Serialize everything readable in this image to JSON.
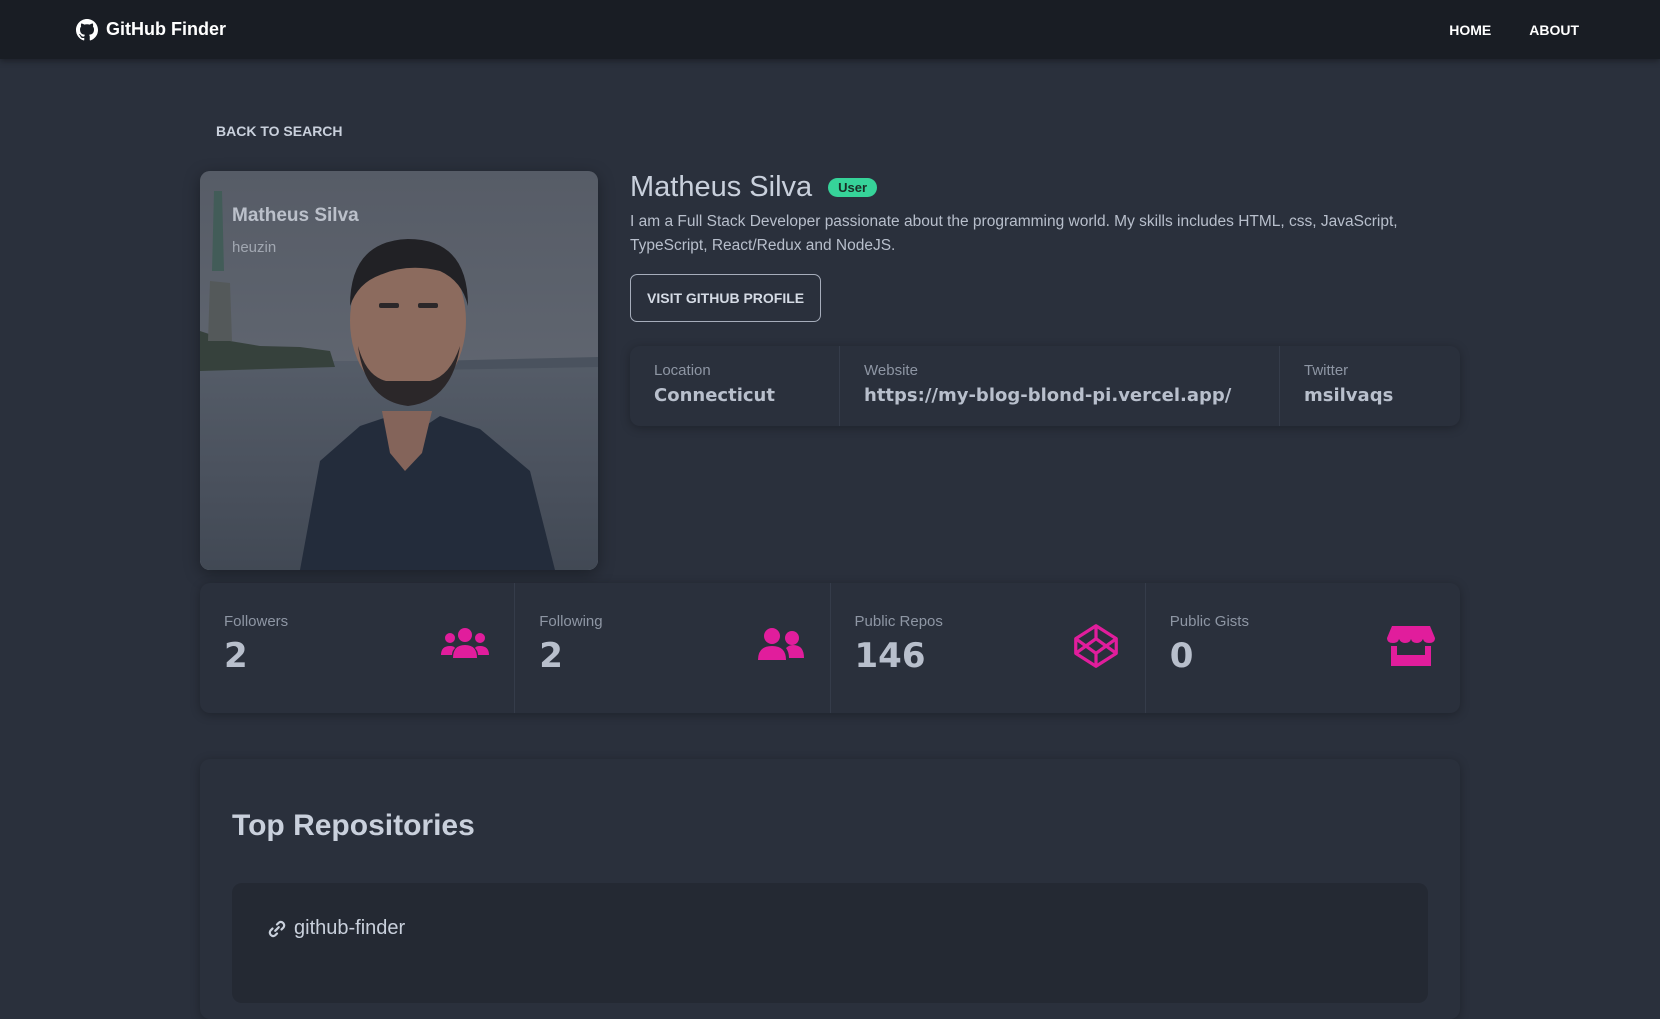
{
  "navbar": {
    "brand": "GitHub Finder",
    "brand_icon": "github-icon",
    "links": [
      "HOME",
      "ABOUT"
    ]
  },
  "back_button": "BACK TO SEARCH",
  "avatar": {
    "overlay_name": "Matheus Silva",
    "overlay_login": "heuzin"
  },
  "profile": {
    "name": "Matheus Silva",
    "badge": "User",
    "bio": "I am a Full Stack Developer passionate about the programming world. My skills includes HTML, css, JavaScript, TypeScript, React/Redux and NodeJS.",
    "visit_button": "VISIT GITHUB PROFILE"
  },
  "info": {
    "location_title": "Location",
    "location_value": "Connecticut",
    "website_title": "Website",
    "website_value": "https://my-blog-blond-pi.vercel.app/",
    "twitter_title": "Twitter",
    "twitter_value": "msilvaqs"
  },
  "stats": {
    "followers_title": "Followers",
    "followers_value": "2",
    "following_title": "Following",
    "following_value": "2",
    "repos_title": "Public Repos",
    "repos_value": "146",
    "gists_title": "Public Gists",
    "gists_value": "0",
    "icons": [
      "users-icon",
      "user-friends-icon",
      "codepen-icon",
      "store-icon"
    ],
    "icon_color": "#e11d9c"
  },
  "repos": {
    "title": "Top Repositories",
    "items": [
      {
        "name": "github-finder",
        "icon": "link-icon"
      }
    ]
  },
  "colors": {
    "background": "#2a303c",
    "navbar": "#191d24",
    "badge": "#36d399",
    "accent": "#e11d9c"
  }
}
